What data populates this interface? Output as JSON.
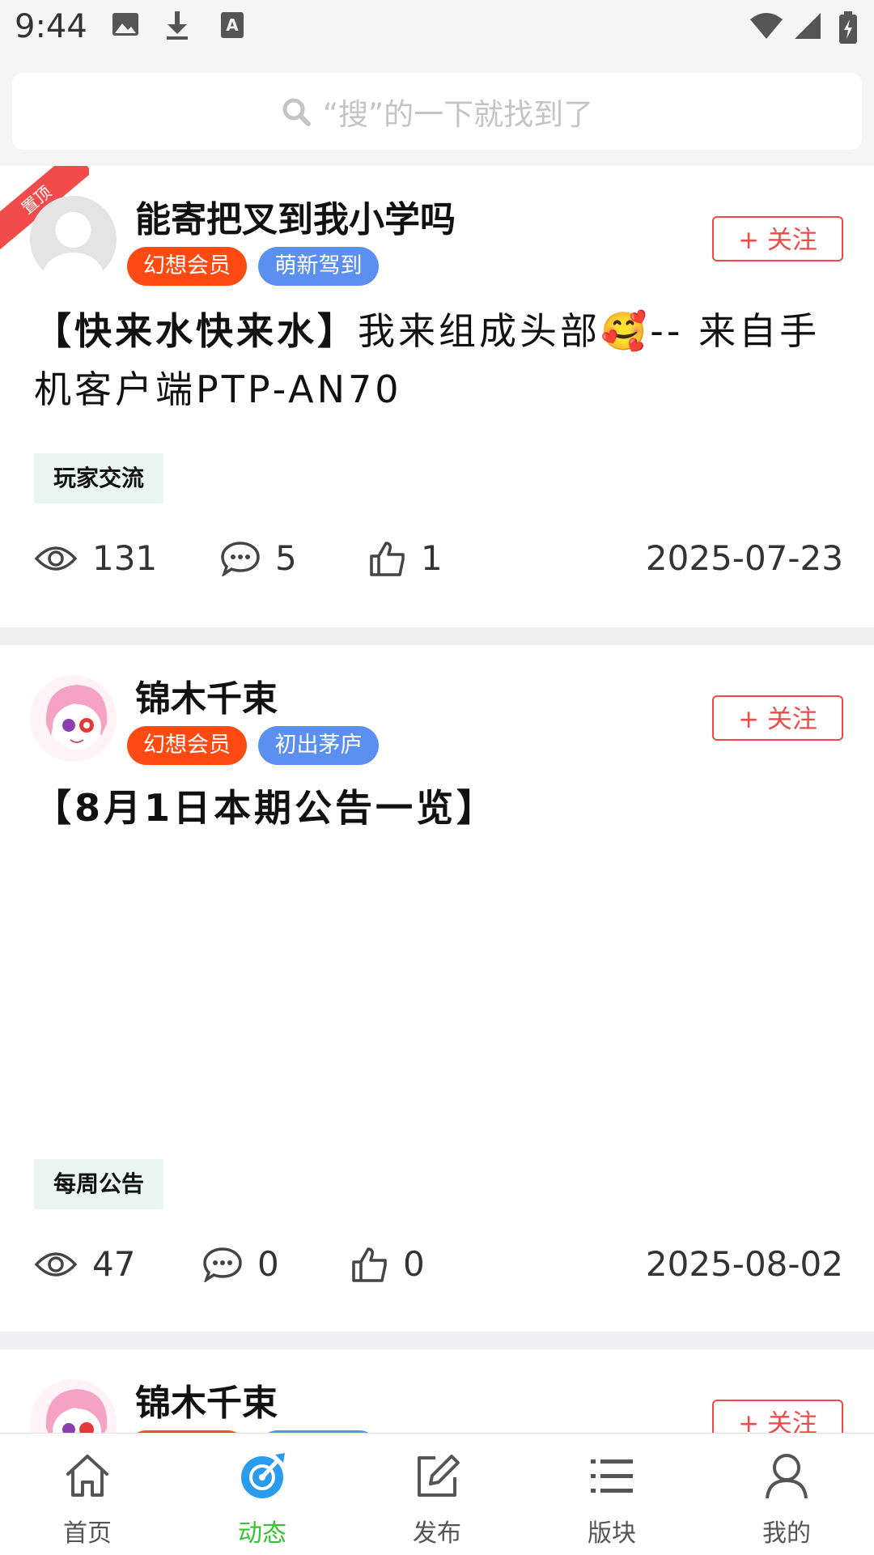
{
  "status_bar": {
    "time": "9:44"
  },
  "search": {
    "placeholder": "“搜”的一下就找到了"
  },
  "posts": [
    {
      "pinned_label": "置顶",
      "username": "能寄把叉到我小学吗",
      "badge_vip": "幻想会员",
      "badge_level": "萌新驾到",
      "follow_label": "+ 关注",
      "title_bold": "【快来水快来水】",
      "title_rest": "我来组成头部🥰-- 来自手机客户端PTP-AN70",
      "tag": "玩家交流",
      "views": "131",
      "comments": "5",
      "likes": "1",
      "date": "2025-07-23"
    },
    {
      "username": "锦木千束",
      "badge_vip": "幻想会员",
      "badge_level": "初出茅庐",
      "follow_label": "+ 关注",
      "title_bold": "【8月1日本期公告一览】",
      "tag": "每周公告",
      "views": "47",
      "comments": "0",
      "likes": "0",
      "date": "2025-08-02"
    },
    {
      "username": "锦木千束",
      "follow_label": "+ 关注"
    }
  ],
  "bottom_nav": {
    "items": [
      {
        "label": "首页"
      },
      {
        "label": "动态"
      },
      {
        "label": "发布"
      },
      {
        "label": "版块"
      },
      {
        "label": "我的"
      }
    ],
    "active": "动态"
  },
  "colors": {
    "accent_green": "#35c335",
    "follow_red": "#ef4a4a",
    "vip_orange": "#ff4a14",
    "level_blue": "#5b8ff0",
    "active_nav_blue": "#2b9bef"
  }
}
